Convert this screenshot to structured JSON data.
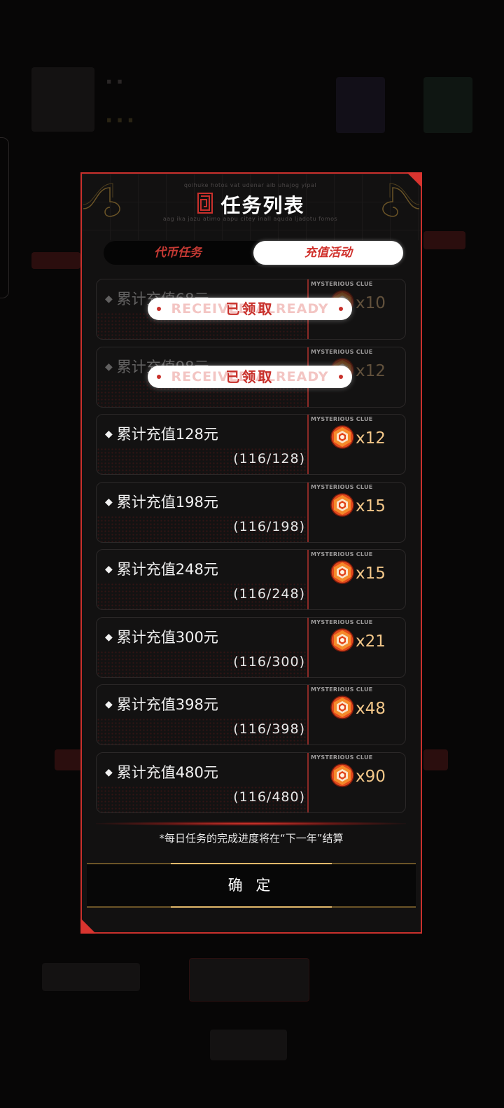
{
  "colors": {
    "accent_red": "#c9302c",
    "gold": "#f4c88a",
    "panel": "#121111"
  },
  "modal": {
    "title": "任务列表",
    "header_noise_top": "qoihuke hotos vat udenar aib uhajog yipal",
    "header_noise_bottom": "aag ika jazu atimo aapu citey inall aquda ljadotu fomos",
    "tabs": [
      {
        "label": "代币任务",
        "active": false
      },
      {
        "label": "充值活动",
        "active": true
      }
    ],
    "reward_label": "MYSTERIOUS CLUE",
    "reward_icon": "mysterious-clue-coin-icon",
    "claimed_label": "已领取",
    "claimed_ghost": "RECEIVED ALREADY",
    "tasks": [
      {
        "name": "累计充值68元",
        "progress": "",
        "amount": "x10",
        "claimed": true
      },
      {
        "name": "累计充值98元",
        "progress": "",
        "amount": "x12",
        "claimed": true
      },
      {
        "name": "累计充值128元",
        "progress": "(116/128)",
        "amount": "x12",
        "claimed": false
      },
      {
        "name": "累计充值198元",
        "progress": "(116/198)",
        "amount": "x15",
        "claimed": false
      },
      {
        "name": "累计充值248元",
        "progress": "(116/248)",
        "amount": "x15",
        "claimed": false
      },
      {
        "name": "累计充值300元",
        "progress": "(116/300)",
        "amount": "x21",
        "claimed": false
      },
      {
        "name": "累计充值398元",
        "progress": "(116/398)",
        "amount": "x48",
        "claimed": false
      },
      {
        "name": "累计充值480元",
        "progress": "(116/480)",
        "amount": "x90",
        "claimed": false
      }
    ],
    "footnote": "*每日任务的完成进度将在“下一年”结算",
    "confirm_label": "确 定"
  }
}
